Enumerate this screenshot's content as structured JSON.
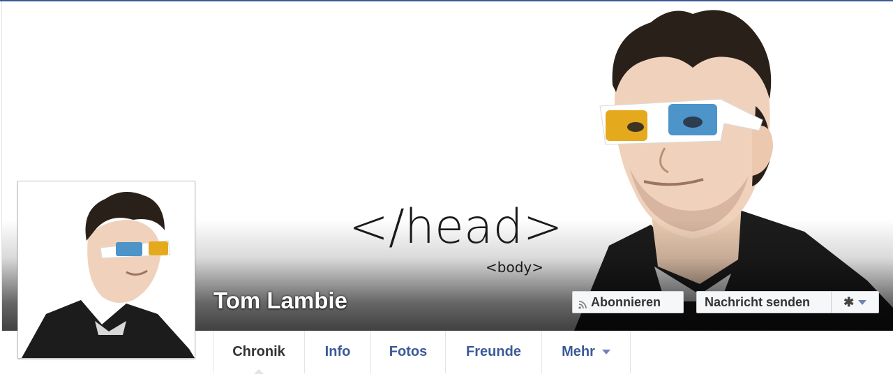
{
  "cover": {
    "title_text": "</head>",
    "subtitle_text": "<body>"
  },
  "profile": {
    "name": "Tom Lambie"
  },
  "actions": {
    "subscribe_label": "Abonnieren",
    "message_label": "Nachricht senden",
    "settings_icon": "gear-icon"
  },
  "tabs": [
    {
      "label": "Chronik",
      "active": true
    },
    {
      "label": "Info"
    },
    {
      "label": "Fotos"
    },
    {
      "label": "Freunde"
    },
    {
      "label": "Mehr"
    }
  ],
  "colors": {
    "link": "#3b5998",
    "active_tab": "#333333"
  }
}
